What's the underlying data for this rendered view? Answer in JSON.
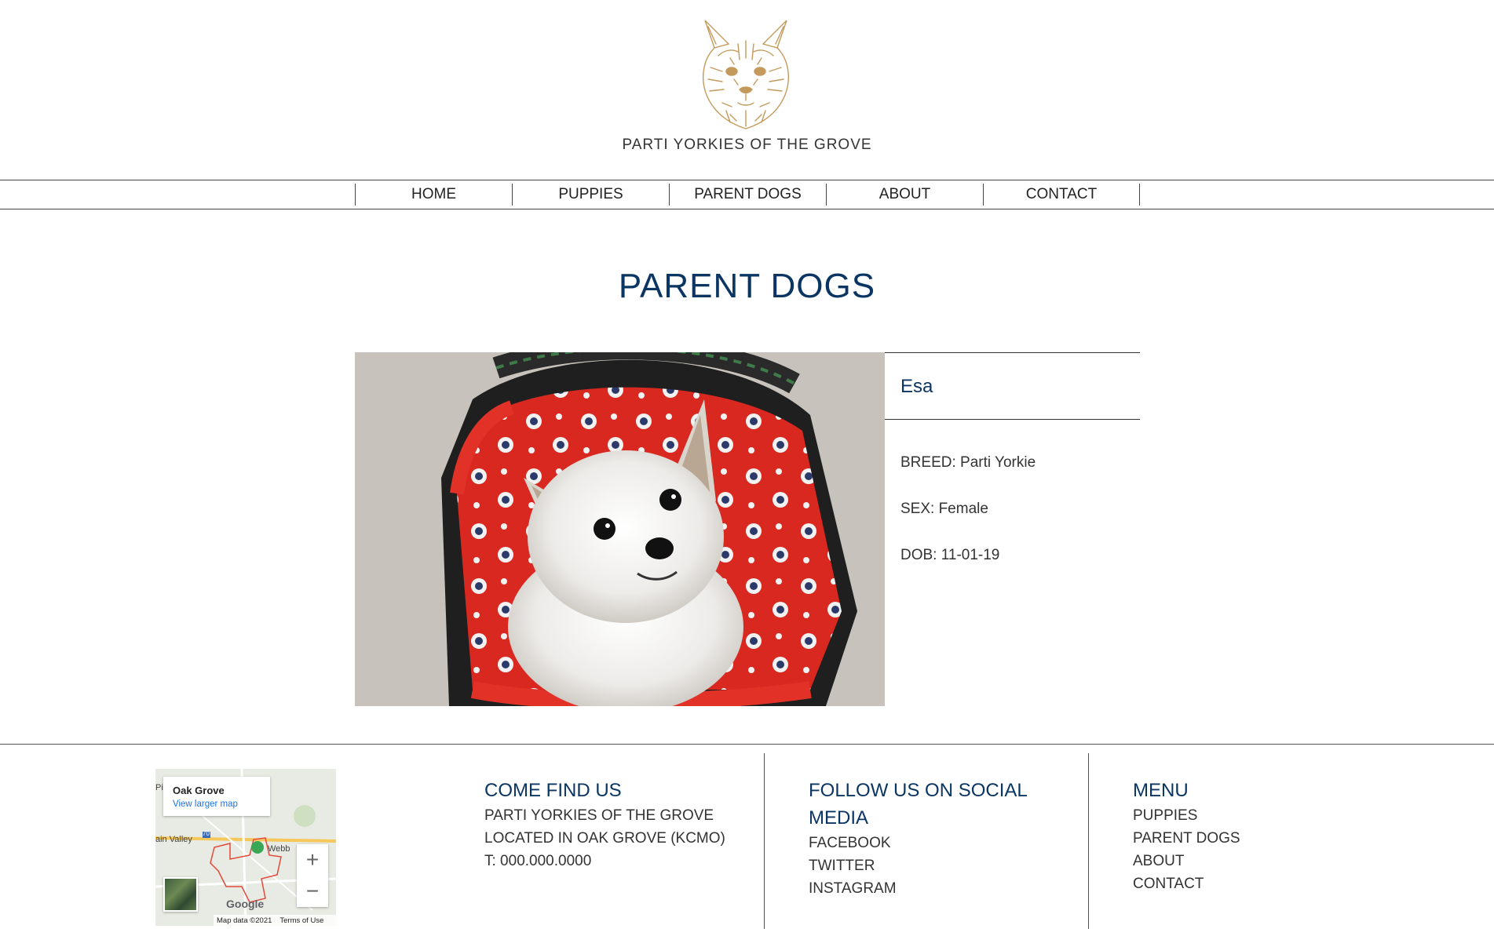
{
  "header": {
    "brand": "PARTI YORKIES OF THE GROVE",
    "logo_icon": "yorkie-sketch-logo",
    "logo_color": "#c49a5c"
  },
  "nav": {
    "items": [
      "HOME",
      "PUPPIES",
      "PARENT DOGS",
      "ABOUT",
      "CONTACT"
    ]
  },
  "page": {
    "title": "PARENT DOGS",
    "title_color": "#0b3563"
  },
  "dog": {
    "name": "Esa",
    "breed": "BREED: Parti Yorkie",
    "sex": "SEX: Female",
    "dob": "DOB: 11-01-19"
  },
  "map": {
    "place": "Oak Grove",
    "view_larger": "View larger map",
    "labels": [
      "Pin",
      "ain Valley",
      "Webb",
      "70"
    ],
    "brand": "Google",
    "attribution": "Map data ©2021",
    "terms": "Terms of Use",
    "zoom_in": "+",
    "zoom_out": "−"
  },
  "footer": {
    "find_us": {
      "heading": "COME FIND US",
      "lines": [
        "PARTI YORKIES OF THE GROVE",
        "LOCATED IN OAK GROVE (KCMO)",
        "T: 000.000.0000"
      ]
    },
    "social": {
      "heading": "FOLLOW US ON SOCIAL MEDIA",
      "links": [
        "FACEBOOK",
        "TWITTER",
        "INSTAGRAM"
      ]
    },
    "menu": {
      "heading": "MENU",
      "links": [
        "PUPPIES",
        "PARENT DOGS",
        "ABOUT",
        "CONTACT"
      ]
    }
  }
}
